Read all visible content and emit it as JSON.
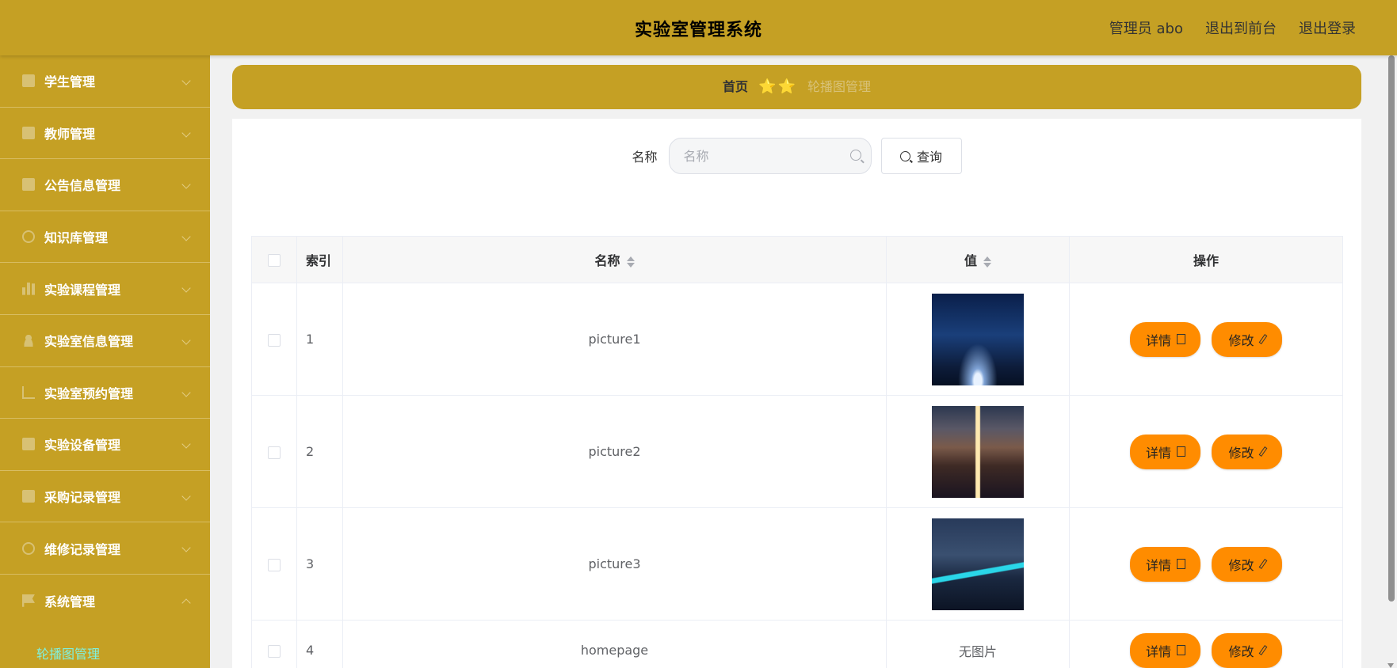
{
  "header": {
    "title": "实验室管理系统",
    "admin_label": "管理员 abo",
    "to_frontend": "退出到前台",
    "logout": "退出登录"
  },
  "sidebar": {
    "items": [
      {
        "label": "学生管理",
        "icon": "monitor-icon"
      },
      {
        "label": "教师管理",
        "icon": "books-icon"
      },
      {
        "label": "公告信息管理",
        "icon": "briefcase-icon"
      },
      {
        "label": "知识库管理",
        "icon": "power-icon"
      },
      {
        "label": "实验课程管理",
        "icon": "bar-chart-icon"
      },
      {
        "label": "实验室信息管理",
        "icon": "user-icon"
      },
      {
        "label": "实验室预约管理",
        "icon": "crop-icon"
      },
      {
        "label": "实验设备管理",
        "icon": "computer-icon"
      },
      {
        "label": "采购记录管理",
        "icon": "document-icon"
      },
      {
        "label": "维修记录管理",
        "icon": "globe-icon"
      },
      {
        "label": "系统管理",
        "icon": "flag-icon"
      }
    ],
    "sub_item": "轮播图管理"
  },
  "breadcrumb": {
    "home": "首页",
    "separator": "⭐⭐",
    "current": "轮播图管理"
  },
  "search": {
    "label": "名称",
    "placeholder": "名称",
    "button": "查询"
  },
  "table": {
    "headers": {
      "index": "索引",
      "name": "名称",
      "value": "值",
      "ops": "操作"
    },
    "rows": [
      {
        "index": "1",
        "name": "picture1",
        "value": "",
        "has_image": true
      },
      {
        "index": "2",
        "name": "picture2",
        "value": "",
        "has_image": true
      },
      {
        "index": "3",
        "name": "picture3",
        "value": "",
        "has_image": true
      },
      {
        "index": "4",
        "name": "homepage",
        "value": "无图片",
        "has_image": false
      }
    ],
    "detail_label": "详情",
    "edit_label": "修改"
  },
  "colors": {
    "primary": "#c5a024",
    "action": "#ff8c00",
    "active_sub": "#7ff2e0"
  }
}
